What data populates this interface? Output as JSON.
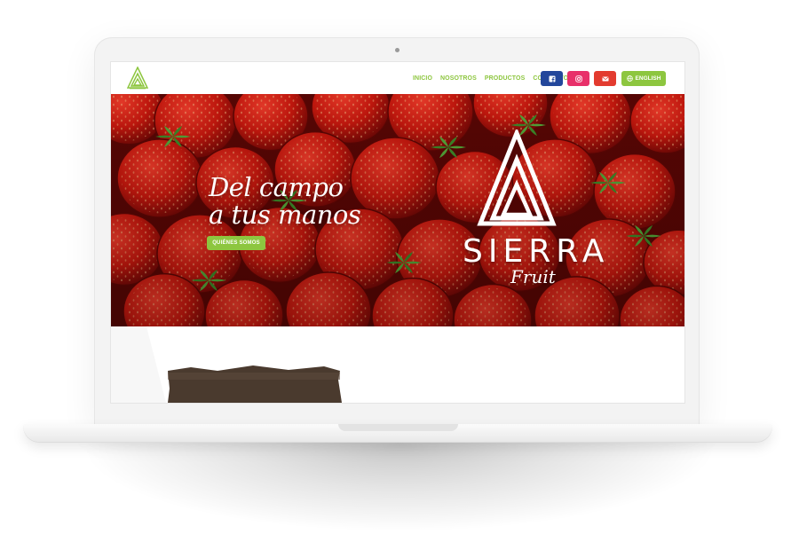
{
  "nav": {
    "items": [
      {
        "label": "INICIO"
      },
      {
        "label": "NOSOTROS"
      },
      {
        "label": "PRODUCTOS"
      },
      {
        "label": "CONTACTO"
      }
    ],
    "social": {
      "facebook": "facebook-icon",
      "instagram": "instagram-icon",
      "email": "envelope-icon"
    },
    "language_label": "ENGLISH",
    "language_icon": "globe-icon"
  },
  "hero": {
    "headline_line1": "Del campo",
    "headline_line2": "a tus manos",
    "cta_label": "QUIÉNES SOMOS",
    "brand_name": "SIERRA",
    "brand_sub": "Fruit"
  },
  "colors": {
    "accent_green": "#8dc63f",
    "facebook_blue": "#23479b",
    "instagram_pink": "#e8306a",
    "email_red": "#e33b2f",
    "hero_red": "#c0180f"
  }
}
